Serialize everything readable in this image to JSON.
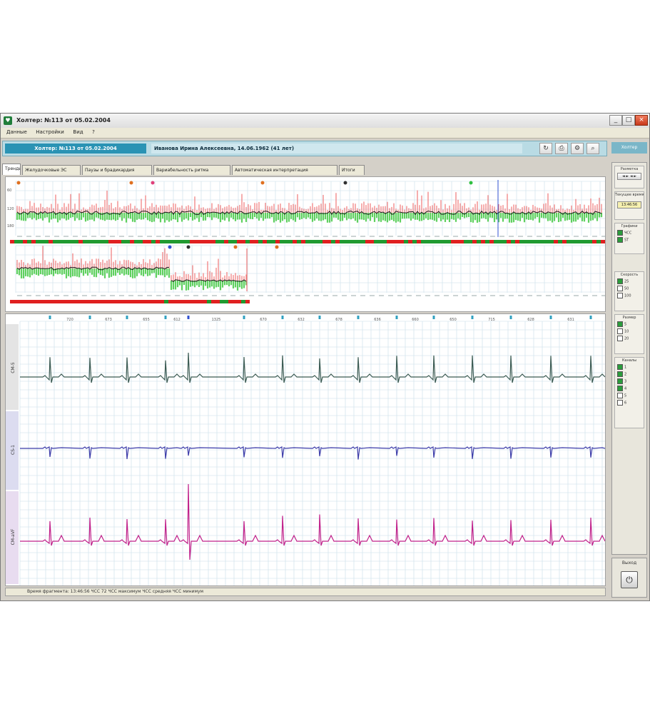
{
  "window": {
    "title": "Холтер: №113 от 05.02.2004",
    "menu": [
      "Данные",
      "Настройки",
      "Вид",
      "?"
    ],
    "min_glyph": "_",
    "max_glyph": "□",
    "close_glyph": "×"
  },
  "infobar": {
    "record": "Холтер: №113 от 05.02.2004",
    "patient": "Иванова Ирина Алексеевна,   14.06.1962  (41 лет)"
  },
  "side_header": "Холтер",
  "tabs": [
    "Тренды",
    "Желудочковые ЭС",
    "Паузы и брадикардия",
    "Вариабельность ритма",
    "Автоматическая интерпретация",
    "Итоги"
  ],
  "side_panel": {
    "group1_label": "Разметка",
    "group1_buttons": [
      "◄ ► ◄ ►"
    ],
    "group2_label": "Текущее время",
    "group2_value": "13:46:56",
    "group3_label": "Графики",
    "group3_items": [
      "ЧСС",
      "ST"
    ],
    "group4_label": "Скорость",
    "group4_items": [
      "25",
      "50",
      "100"
    ],
    "group5_label": "Размер",
    "group5_items": [
      "5",
      "10",
      "20"
    ],
    "group6_label": "Каналы",
    "group6_items": [
      "1",
      "2",
      "3",
      "4",
      "5",
      "6"
    ]
  },
  "ecg_channels": [
    "CM-5",
    "CS-1",
    "CM-aVF"
  ],
  "rr_labels": [
    "720",
    "673",
    "655",
    "612",
    "1325",
    "670",
    "632",
    "678",
    "636",
    "660",
    "650",
    "715",
    "628",
    "631"
  ],
  "trend_axis_top": [
    "60",
    "120",
    "180"
  ],
  "status_text": "Время фрагмента: 13:46:56   ЧСС 72   ЧСС максимум   ЧСС средняя   ЧСС минимум",
  "exit_label": "Выход",
  "exit_icon": "⏻",
  "colors": {
    "hr_line": "#1a1a1a",
    "hr_red": "#f07878",
    "hr_green": "#5fd05f",
    "ecg1": "#3a5a52",
    "ecg2": "#3a3aa8",
    "ecg3": "#c0208a",
    "grid": "#c8dde8",
    "bar_red": "#e02020",
    "bar_green": "#209a30"
  }
}
